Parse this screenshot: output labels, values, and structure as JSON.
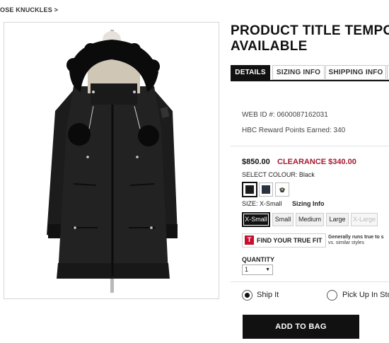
{
  "breadcrumb": {
    "text": "OSE KNUCKLES >"
  },
  "product": {
    "title_line1": "PRODUCT TITLE TEMPO",
    "title_line2": "AVAILABLE",
    "image_alt": "black hooded parka with fur trim"
  },
  "tabs": [
    {
      "label": "DETAILS",
      "active": true
    },
    {
      "label": "SIZING INFO",
      "active": false
    },
    {
      "label": "SHIPPING INFO",
      "active": false
    }
  ],
  "meta": {
    "web_id": "WEB ID #: 0600087162031",
    "reward_points": "HBC Reward Points Earned: 340"
  },
  "pricing": {
    "regular": "$850.00",
    "clearance": "CLEARANCE $340.00",
    "clearance_color": "#a3192f"
  },
  "colour": {
    "label": "SELECT COLOUR:",
    "selected": "Black",
    "swatches": [
      {
        "name": "black",
        "hex": "#1b1b1b",
        "selected": true
      },
      {
        "name": "navy",
        "hex": "#2c3340",
        "selected": false
      },
      {
        "name": "pattern",
        "hex": "#3a3a3a",
        "selected": false
      }
    ]
  },
  "size": {
    "label": "SIZE:",
    "selected": "X-Small",
    "sizing_info_link": "Sizing Info",
    "options": [
      {
        "label": "X-Small",
        "selected": true,
        "disabled": false
      },
      {
        "label": "Small",
        "selected": false,
        "disabled": false
      },
      {
        "label": "Medium",
        "selected": false,
        "disabled": false
      },
      {
        "label": "Large",
        "selected": false,
        "disabled": false
      },
      {
        "label": "X-Large",
        "selected": false,
        "disabled": true
      }
    ]
  },
  "fit": {
    "icon_letter": "T",
    "button_label": "FIND YOUR TRUE FIT",
    "note_line1": "Generally runs true to s",
    "note_line2": "vs. similar styles"
  },
  "quantity": {
    "label": "QUANTITY",
    "value": "1",
    "arrow": "▼"
  },
  "delivery": {
    "options": [
      {
        "label": "Ship It",
        "selected": true
      },
      {
        "label": "Pick Up In Sto",
        "selected": false
      }
    ]
  },
  "cta": {
    "add_to_bag": "ADD TO BAG"
  }
}
